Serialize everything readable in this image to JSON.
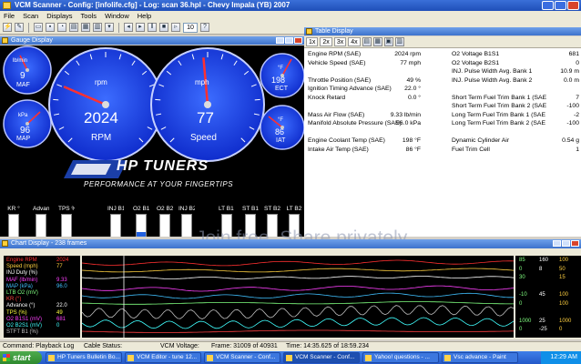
{
  "window": {
    "title": "VCM Scanner - Config: [infolife.cfg] - Log: scan 36.hpl - Chevy Impala (YB) 2007"
  },
  "menu": [
    "File",
    "Scan",
    "Displays",
    "Tools",
    "Window",
    "Help"
  ],
  "toolbar": {
    "speed_value": "10"
  },
  "gauge_display": {
    "title": "Gauge Display",
    "rpm": {
      "value": "2024",
      "label": "RPM",
      "unit": "rpm",
      "max": 8000,
      "reading": 2024
    },
    "speed": {
      "value": "77",
      "label": "Speed",
      "unit": "mph",
      "max": 160,
      "reading": 77
    },
    "small_gauges": [
      {
        "label": "MAF",
        "unit": "lb/min",
        "value": "9"
      },
      {
        "label": "MAP",
        "unit": "kPa",
        "value": "96"
      },
      {
        "label": "ECT",
        "unit": "°F",
        "value": "198"
      },
      {
        "label": "IAT",
        "unit": "°F",
        "value": "86"
      }
    ],
    "banner": {
      "brand": "HP TUNERS",
      "tagline": "PERFORMANCE AT YOUR FINGERTIPS"
    },
    "bars": [
      {
        "label": "KR °",
        "value": "0",
        "fill": 0.0,
        "color": "#e02020"
      },
      {
        "label": "Advance",
        "value": "22.0",
        "fill": 0.55,
        "color": "#2060e0"
      },
      {
        "label": "TPS %",
        "value": "49",
        "fill": 0.49,
        "color": "#2060e0"
      },
      {
        "label": "INJ B1",
        "value": "10.9",
        "fill": 0.45,
        "color": "#2060e0"
      },
      {
        "label": "O2 B1",
        "value": "681",
        "fill": 0.68,
        "color": "#2060e0"
      },
      {
        "label": "O2 B2",
        "value": "0",
        "fill": 0.0,
        "color": "#2060e0"
      },
      {
        "label": "INJ B2",
        "value": "",
        "fill": 0.4,
        "color": "#2060e0"
      },
      {
        "label": "LT B1 %",
        "value": "-2.3",
        "fill": 0.47,
        "color": "#2060e0"
      },
      {
        "label": "ST B1",
        "value": "7.0",
        "fill": 0.55,
        "color": "#2060e0"
      },
      {
        "label": "ST B2",
        "value": "-100.0",
        "fill": 0.0,
        "color": "#2060e0"
      },
      {
        "label": "LT B2",
        "value": "-100.0",
        "fill": 0.0,
        "color": "#2060e0"
      }
    ]
  },
  "data_list": {
    "title": "Table Display",
    "tabs": [
      "1x",
      "2x",
      "3x",
      "4x"
    ],
    "left": [
      {
        "name": "Engine RPM (SAE)",
        "value": "2024 rpm"
      },
      {
        "name": "Vehicle Speed (SAE)",
        "value": "77 mph"
      },
      {
        "name": "",
        "value": ""
      },
      {
        "name": "Throttle Position (SAE)",
        "value": "49 %"
      },
      {
        "name": "Ignition Timing Advance (SAE)",
        "value": "22.0 °"
      },
      {
        "name": "Knock Retard",
        "value": "0.0 °"
      },
      {
        "name": "",
        "value": ""
      },
      {
        "name": "Mass Air Flow (SAE)",
        "value": "9.33 lb/min"
      },
      {
        "name": "Manifold Absolute Pressure (SAE)",
        "value": "96.0 kPa"
      },
      {
        "name": "",
        "value": ""
      },
      {
        "name": "Engine Coolant Temp (SAE)",
        "value": "198 °F"
      },
      {
        "name": "Intake Air Temp (SAE)",
        "value": "86 °F"
      }
    ],
    "right": [
      {
        "name": "O2 Voltage B1S1",
        "value": "681"
      },
      {
        "name": "O2 Voltage B2S1",
        "value": "0"
      },
      {
        "name": "INJ. Pulse Width Avg. Bank 1",
        "value": "10.9 m"
      },
      {
        "name": "INJ. Pulse Width Avg. Bank 2",
        "value": "0.0 m"
      },
      {
        "name": "",
        "value": ""
      },
      {
        "name": "Short Term Fuel Trim Bank 1 (SAE",
        "value": "7"
      },
      {
        "name": "Short Term Fuel Trim Bank 2 (SAE",
        "value": "-100"
      },
      {
        "name": "Long Term Fuel Trim Bank 1 (SAE",
        "value": "-2"
      },
      {
        "name": "Long Term Fuel Trim Bank 2 (SAE",
        "value": "-100"
      },
      {
        "name": "",
        "value": ""
      },
      {
        "name": "Dynamic Cylinder Air",
        "value": "0.54 g"
      },
      {
        "name": "Fuel Trim Cell",
        "value": "1"
      }
    ]
  },
  "watermark": "Join free. Share privately.",
  "chart_display": {
    "title": "Chart Display - 238 frames",
    "legend": [
      {
        "name": "Engine RPM",
        "value": "2024",
        "color": "#ff3030"
      },
      {
        "name": "Speed (mph)",
        "value": "77",
        "color": "#ffd040"
      },
      {
        "name": "INJ Duty (%)",
        "value": "",
        "color": "#ffffff"
      },
      {
        "name": "MAF (lb/min)",
        "value": "9.33",
        "color": "#ff40ff"
      },
      {
        "name": "MAP (kPa)",
        "value": "96.0",
        "color": "#40c0ff"
      },
      {
        "name": "LTB O2 (mV)",
        "value": "",
        "color": "#80ff80"
      },
      {
        "name": "KR (°)",
        "value": "",
        "color": "#ff4040"
      },
      {
        "name": "Advance (°)",
        "value": "22.0",
        "color": "#ffffff"
      },
      {
        "name": "TPS (%)",
        "value": "49",
        "color": "#ffff40"
      },
      {
        "name": "O2 B1S1 (mV)",
        "value": "681",
        "color": "#ff40ff"
      },
      {
        "name": "O2 B2S1 (mV)",
        "value": "0",
        "color": "#40ffff"
      },
      {
        "name": "STFT B1 (%)",
        "value": "",
        "color": "#c0c0c0"
      }
    ],
    "right_values": [
      {
        "a": "85",
        "b": "160",
        "c": "100"
      },
      {
        "a": "0",
        "b": "8",
        "c": "50"
      },
      {
        "a": "30",
        "b": "",
        "c": "15"
      },
      {
        "a": "",
        "b": "",
        "c": ""
      },
      {
        "a": "-10",
        "b": "45",
        "c": "100"
      },
      {
        "a": "0",
        "b": "",
        "c": "100"
      },
      {
        "a": "",
        "b": "",
        "c": ""
      },
      {
        "a": "1000",
        "b": "25",
        "c": "1000"
      },
      {
        "a": "0",
        "b": "-25",
        "c": "0"
      }
    ]
  },
  "statusbar": {
    "command": "Command: Playback Log",
    "cable": "Cable Status:",
    "vcm_voltage": "VCM Voltage:",
    "frame": "Frame: 31009 of 40931",
    "time": "Time: 14:35.625 of 18:59.234"
  },
  "taskbar": {
    "start": "start",
    "tasks": [
      "HP Tuners Bulletin Bo...",
      "VCM Editor - tune 12...",
      "VCM Scanner - Conf...",
      "VCM Scanner - Conf...",
      "Yahoo! questions - ...",
      "Vsc advance - Paint"
    ],
    "clock": "12:29 AM"
  }
}
